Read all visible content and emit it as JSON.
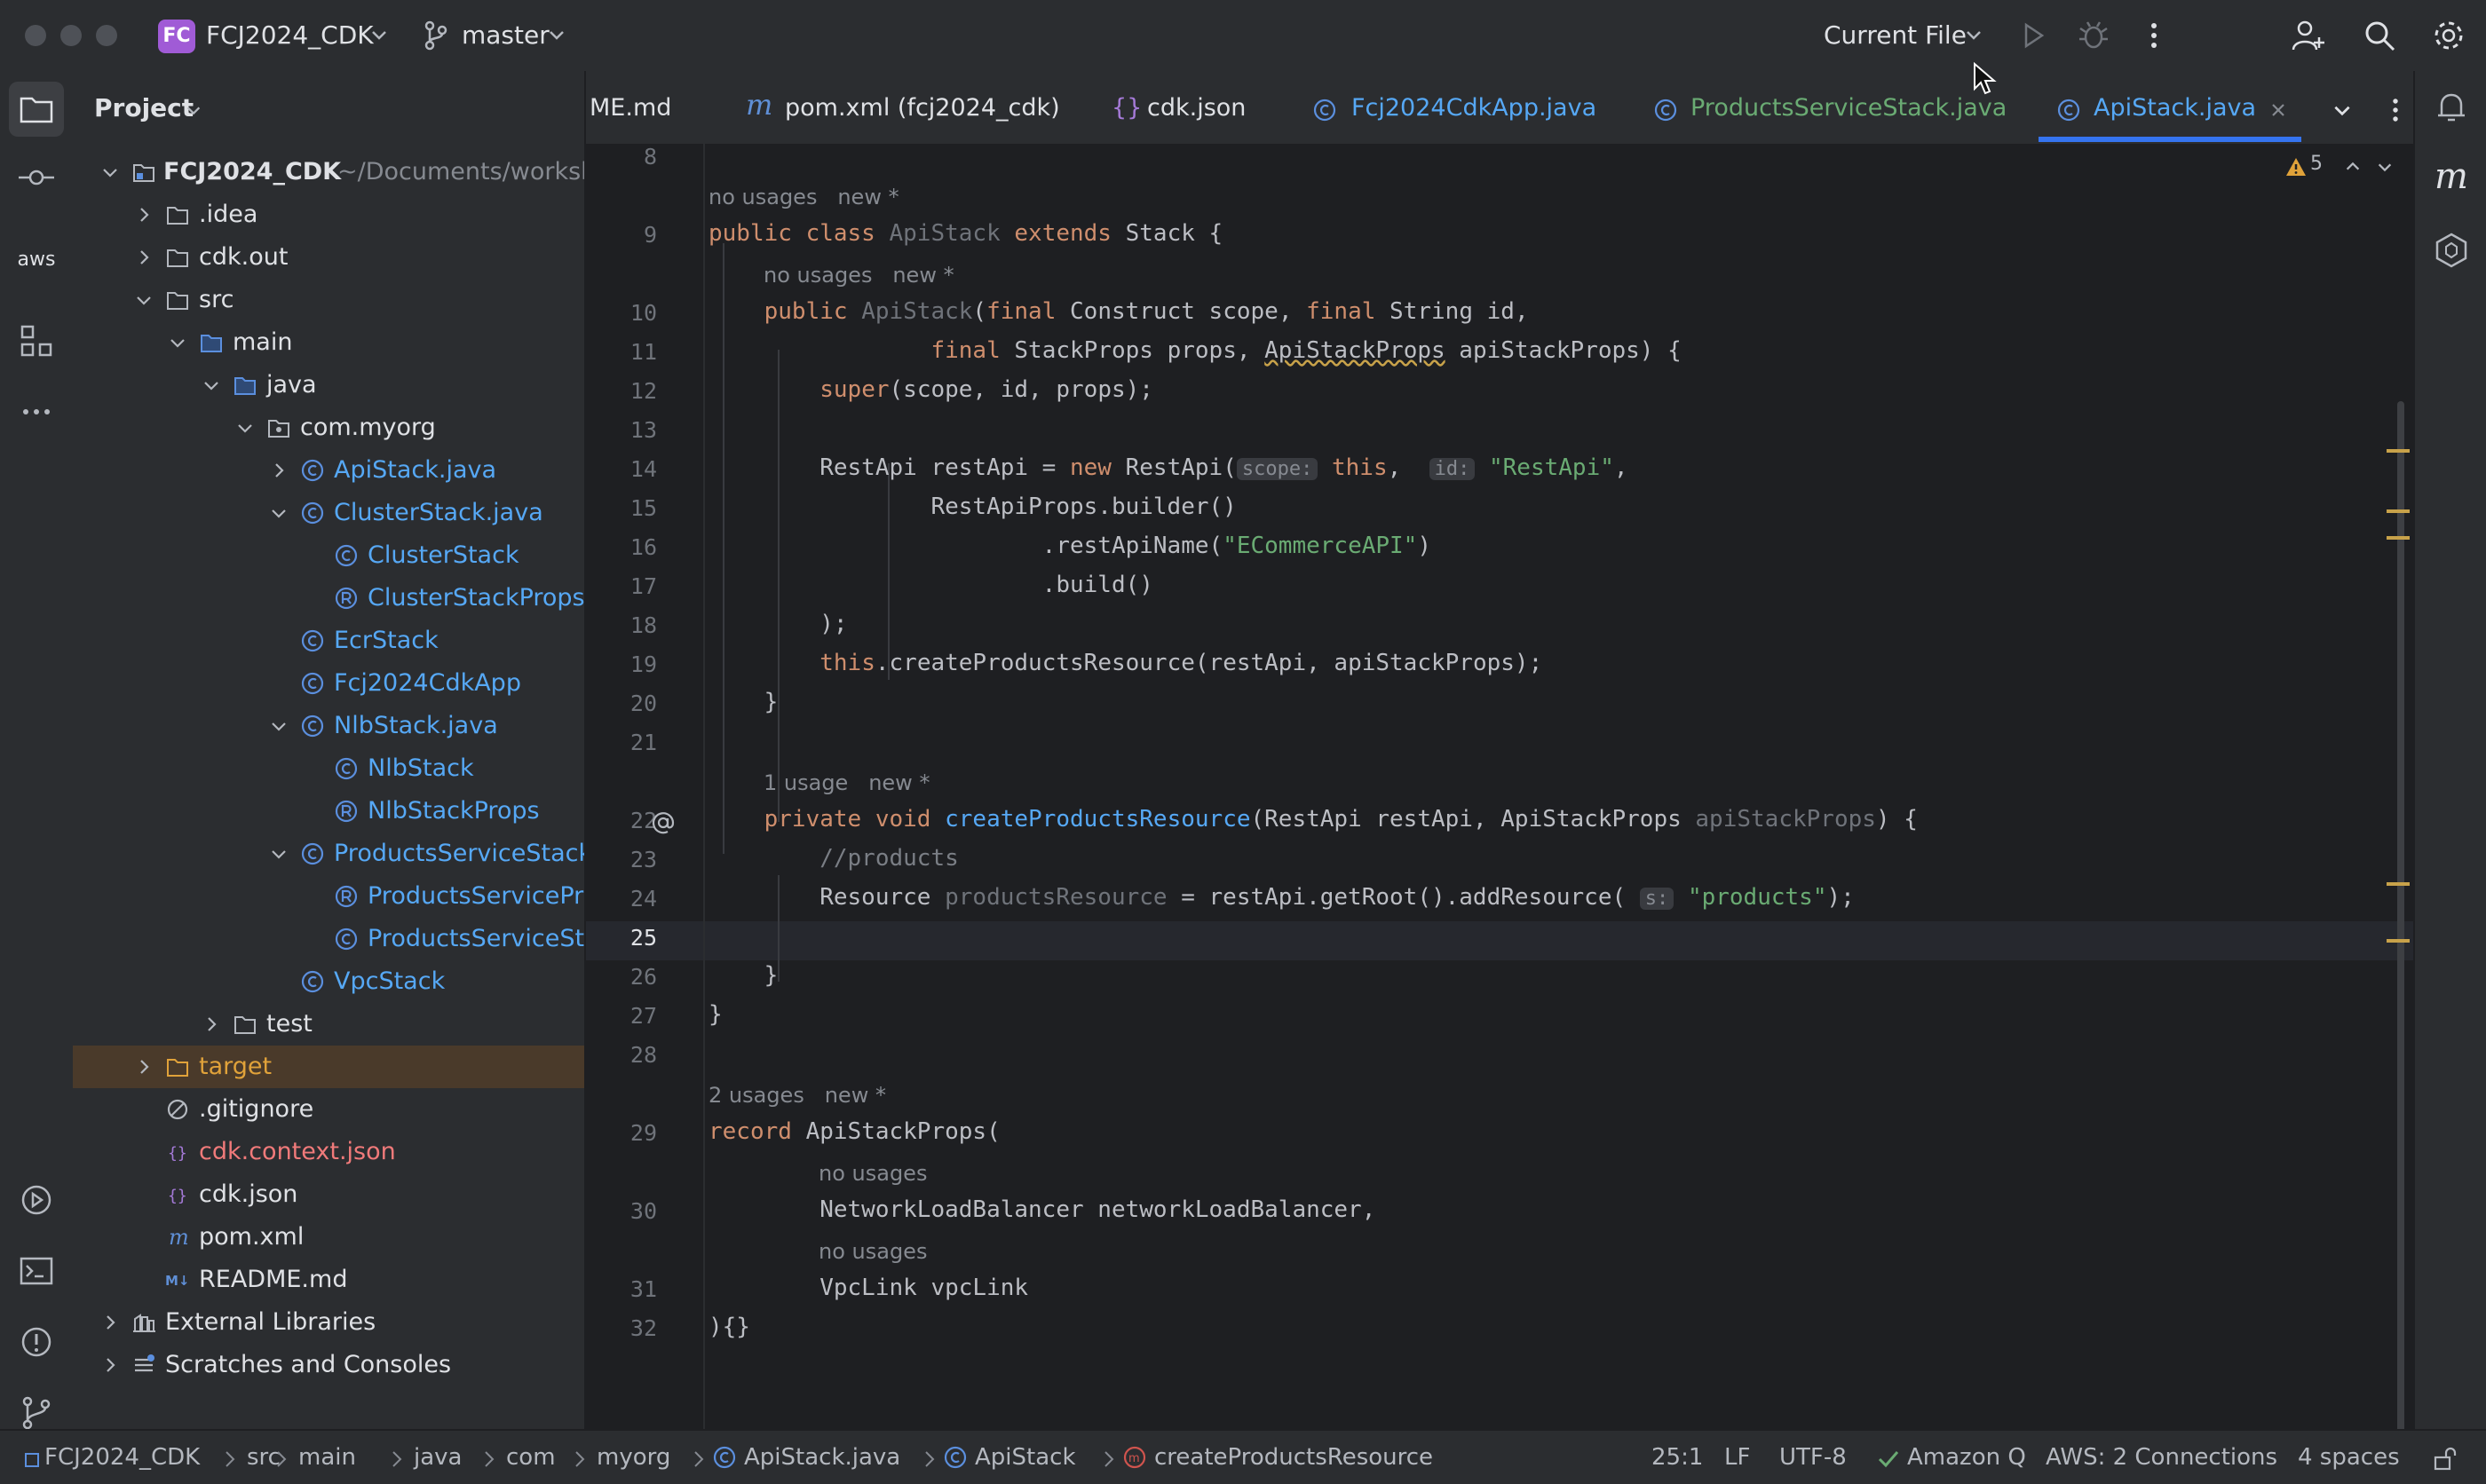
{
  "titlebar": {
    "project_badge": "FC",
    "project_name": "FCJ2024_CDK",
    "branch": "master",
    "run_config": "Current File"
  },
  "project_panel": {
    "title": "Project",
    "root": {
      "name": "FCJ2024_CDK",
      "path": "~/Documents/workshop"
    },
    "items": [
      {
        "label": ".idea"
      },
      {
        "label": "cdk.out"
      },
      {
        "label": "src"
      },
      {
        "label": "main"
      },
      {
        "label": "java"
      },
      {
        "label": "com.myorg"
      },
      {
        "label": "ApiStack.java"
      },
      {
        "label": "ClusterStack.java"
      },
      {
        "label": "ClusterStack"
      },
      {
        "label": "ClusterStackProps"
      },
      {
        "label": "EcrStack"
      },
      {
        "label": "Fcj2024CdkApp"
      },
      {
        "label": "NlbStack.java"
      },
      {
        "label": "NlbStack"
      },
      {
        "label": "NlbStackProps"
      },
      {
        "label": "ProductsServiceStack.j"
      },
      {
        "label": "ProductsServicePro"
      },
      {
        "label": "ProductsServiceSta"
      },
      {
        "label": "VpcStack"
      },
      {
        "label": "test"
      },
      {
        "label": "target"
      },
      {
        "label": ".gitignore"
      },
      {
        "label": "cdk.context.json"
      },
      {
        "label": "cdk.json"
      },
      {
        "label": "pom.xml"
      },
      {
        "label": "README.md"
      },
      {
        "label": "External Libraries"
      },
      {
        "label": "Scratches and Consoles"
      }
    ]
  },
  "tabs": [
    {
      "label": "ME.md"
    },
    {
      "label": "pom.xml (fcj2024_cdk)"
    },
    {
      "label": "cdk.json"
    },
    {
      "label": "Fcj2024CdkApp.java"
    },
    {
      "label": "ProductsServiceStack.java"
    },
    {
      "label": "ApiStack.java"
    }
  ],
  "editor": {
    "warnings_count": "5",
    "line_numbers": [
      "8",
      "9",
      "10",
      "11",
      "12",
      "13",
      "14",
      "15",
      "16",
      "17",
      "18",
      "19",
      "20",
      "21",
      "22",
      "23",
      "24",
      "25",
      "26",
      "27",
      "28",
      "29",
      "30",
      "31",
      "32"
    ],
    "hints": {
      "h9": "no usages   new *",
      "h10": "no usages   new *",
      "h22": "1 usage   new *",
      "h29": "2 usages   new *",
      "h30": "no usages",
      "h31": "no usages"
    },
    "code": {
      "l9_a": "public class ",
      "l9_b": "ApiStack",
      "l9_c": " extends ",
      "l9_d": "Stack {",
      "l10_a": "    public ",
      "l10_b": "ApiStack",
      "l10_c": "(",
      "l10_d": "final",
      "l10_e": " Construct scope, ",
      "l10_f": "final",
      "l10_g": " String id,",
      "l11_a": "                ",
      "l11_b": "final",
      "l11_c": " StackProps props, ",
      "l11_d": "ApiStackProps",
      "l11_e": " apiStackProps) {",
      "l12_a": "        ",
      "l12_b": "super",
      "l12_c": "(scope, id, props);",
      "l14_a": "        RestApi restApi = ",
      "l14_b": "new",
      "l14_c": " RestApi(",
      "l14_p1": "scope:",
      "l14_d": " ",
      "l14_e": "this",
      "l14_f": ",  ",
      "l14_p2": "id:",
      "l14_g": " ",
      "l14_h": "\"RestApi\"",
      "l14_i": ",",
      "l15": "                RestApiProps.builder()",
      "l16_a": "                        .restApiName(",
      "l16_b": "\"ECommerceAPI\"",
      "l16_c": ")",
      "l17": "                        .build()",
      "l18": "        );",
      "l19_a": "        ",
      "l19_b": "this",
      "l19_c": ".createProductsResource(restApi, apiStackProps);",
      "l20": "    }",
      "l22_a": "    ",
      "l22_b": "private void ",
      "l22_c": "createProductsResource",
      "l22_d": "(RestApi restApi, ApiStackProps ",
      "l22_e": "apiStackProps",
      "l22_f": ") {",
      "l23": "        //products",
      "l24_a": "        Resource ",
      "l24_b": "productsResource",
      "l24_c": " = restApi.getRoot().addResource( ",
      "l24_p": "s:",
      "l24_d": " ",
      "l24_e": "\"products\"",
      "l24_f": ");",
      "l26": "    }",
      "l27": "}",
      "l29_a": "record ",
      "l29_b": "ApiStackProps(",
      "l30": "        NetworkLoadBalancer networkLoadBalancer,",
      "l31": "        VpcLink vpcLink",
      "l32": "){}"
    }
  },
  "statusbar": {
    "breadcrumbs": [
      "FCJ2024_CDK",
      "src",
      "main",
      "java",
      "com",
      "myorg",
      "ApiStack.java",
      "ApiStack",
      "createProductsResource"
    ],
    "position": "25:1",
    "line_sep": "LF",
    "encoding": "UTF-8",
    "amazon_q": "Amazon Q",
    "aws": "AWS: 2 Connections",
    "indent": "4 spaces"
  }
}
